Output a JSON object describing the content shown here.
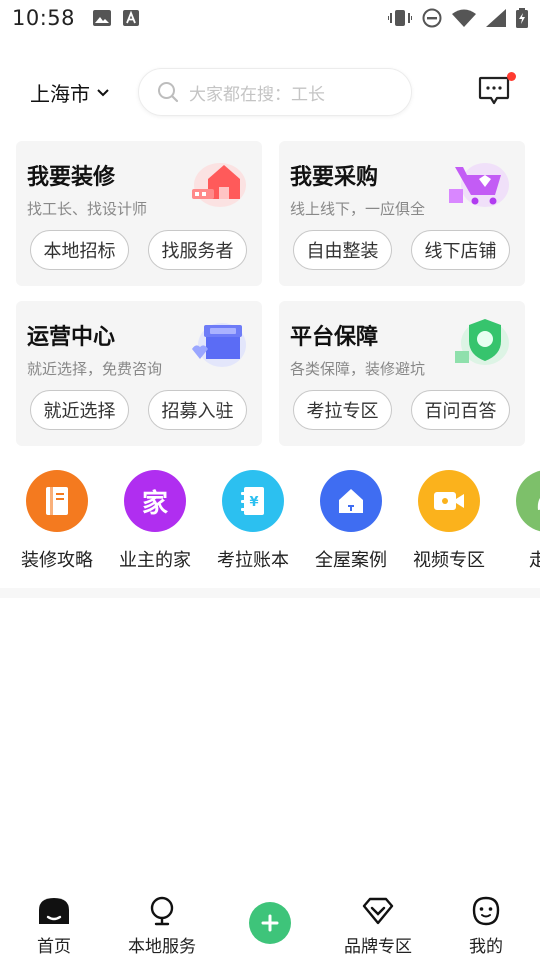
{
  "status_bar": {
    "time": "10:58"
  },
  "header": {
    "city": "上海市",
    "search_placeholder": "大家都在搜：工长"
  },
  "cards": [
    {
      "title": "我要装修",
      "subtitle": "找工长、找设计师",
      "buttons": [
        "本地招标",
        "找服务者"
      ],
      "accent": "#ff5a5a"
    },
    {
      "title": "我要采购",
      "subtitle": "线上线下，一应俱全",
      "buttons": [
        "自由整装",
        "线下店铺"
      ],
      "accent": "#b13cf0"
    },
    {
      "title": "运营中心",
      "subtitle": "就近选择，免费咨询",
      "buttons": [
        "就近选择",
        "招募入驻"
      ],
      "accent": "#5b6cf5"
    },
    {
      "title": "平台保障",
      "subtitle": "各类保障，装修避坑",
      "buttons": [
        "考拉专区",
        "百问百答"
      ],
      "accent": "#36c46d"
    }
  ],
  "quick_links": [
    {
      "label": "装修攻略",
      "color": "#f47a1f",
      "icon": "book-icon"
    },
    {
      "label": "业主的家",
      "color": "#b02ef0",
      "icon": "home-char-icon",
      "glyph": "家"
    },
    {
      "label": "考拉账本",
      "color": "#2cc0f0",
      "icon": "ledger-icon",
      "glyph": "¥"
    },
    {
      "label": "全屋案例",
      "color": "#3f6df2",
      "icon": "house-icon"
    },
    {
      "label": "视频专区",
      "color": "#fbb21c",
      "icon": "video-icon"
    },
    {
      "label": "走近",
      "color": "#7dc06a",
      "icon": "leaf-icon"
    }
  ],
  "bottom_nav": [
    {
      "label": "首页",
      "icon": "home-icon",
      "active": true
    },
    {
      "label": "本地服务",
      "icon": "location-icon"
    },
    {
      "label": "",
      "icon": "plus-icon"
    },
    {
      "label": "品牌专区",
      "icon": "diamond-icon"
    },
    {
      "label": "我的",
      "icon": "profile-icon"
    }
  ],
  "colors": {
    "plus_button": "#3ec47a",
    "notification_dot": "#ff3b30"
  }
}
